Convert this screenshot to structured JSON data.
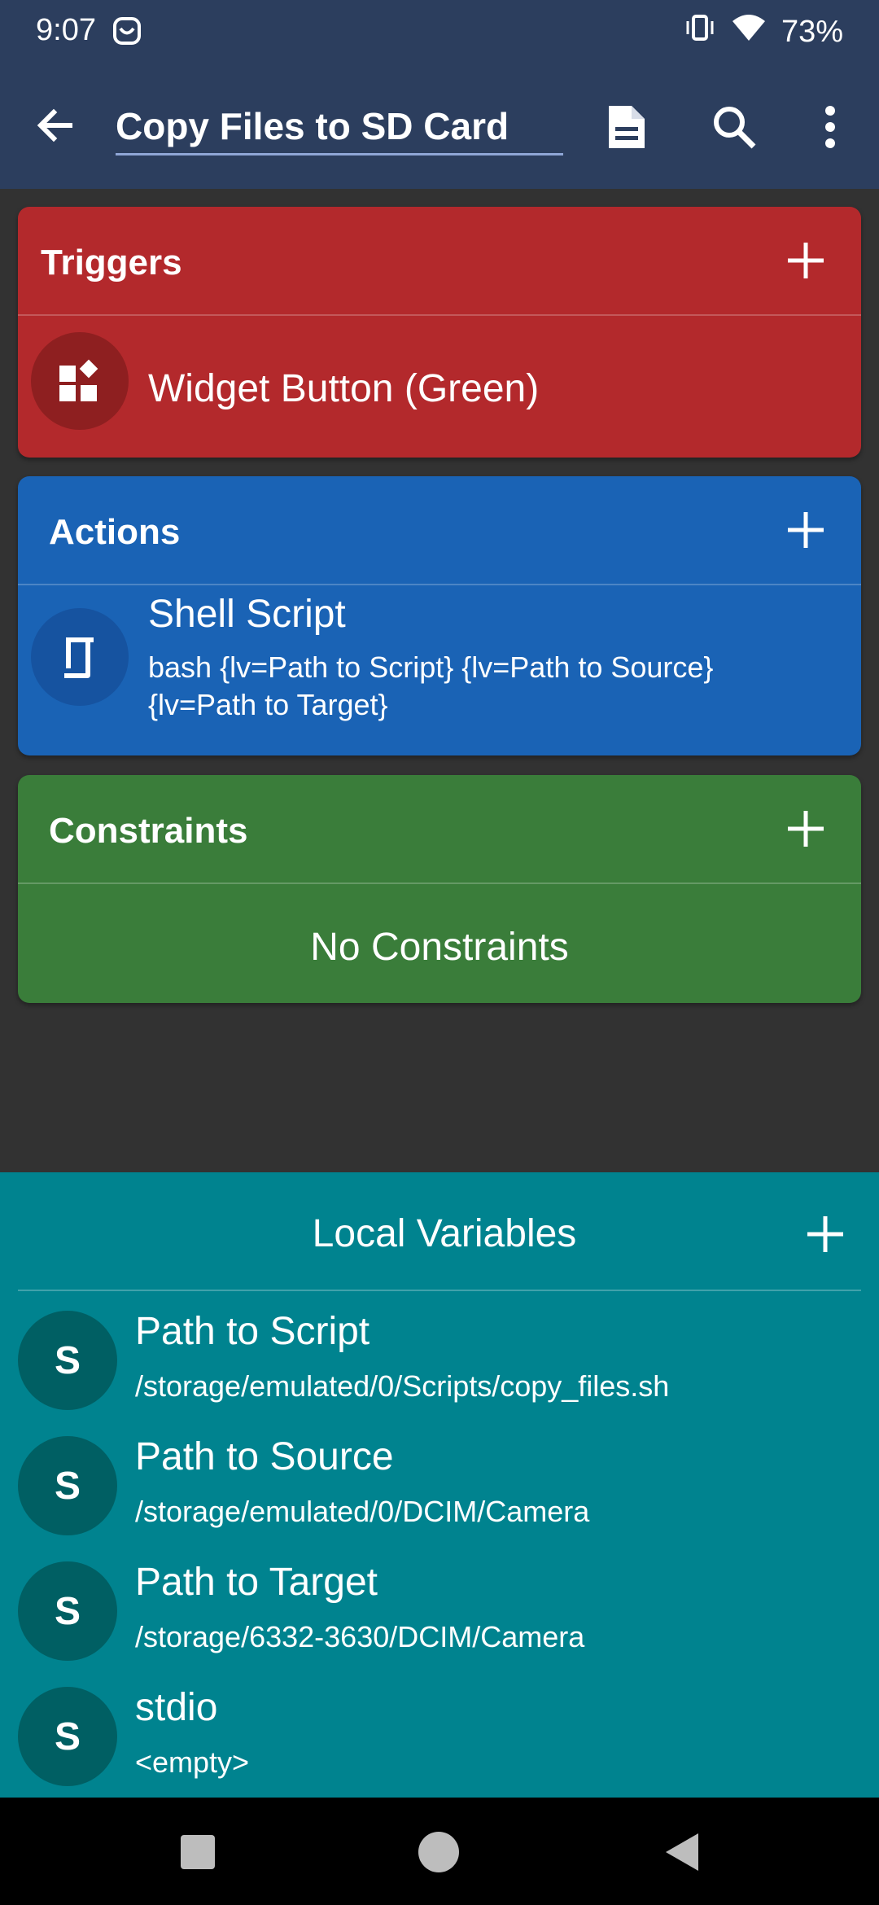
{
  "status_bar": {
    "time": "9:07",
    "battery": "73%"
  },
  "app_bar": {
    "macro_name": "Copy Files to SD Card",
    "icons": [
      "back-arrow-icon",
      "document-icon",
      "search-icon",
      "more-vert-icon"
    ]
  },
  "triggers": {
    "title": "Triggers",
    "color": "#b3292c",
    "items": [
      {
        "label": "Widget Button (Green)",
        "icon": "widget-icon"
      }
    ]
  },
  "actions": {
    "title": "Actions",
    "color": "#1a63b5",
    "items": [
      {
        "label": "Shell Script",
        "detail_line1": "bash {lv=Path to Script} {lv=Path to Source}",
        "detail_line2": "{lv=Path to Target}",
        "icon": "shell-script-icon"
      }
    ]
  },
  "constraints": {
    "title": "Constraints",
    "color": "#3a7d3a",
    "empty_text": "No Constraints"
  },
  "local_variables": {
    "title": "Local Variables",
    "color": "#00838f",
    "items": [
      {
        "type": "S",
        "name": "Path to Script",
        "value": "/storage/emulated/0/Scripts/copy_files.sh"
      },
      {
        "type": "S",
        "name": "Path to Source",
        "value": "/storage/emulated/0/DCIM/Camera"
      },
      {
        "type": "S",
        "name": "Path to Target",
        "value": "/storage/6332-3630/DCIM/Camera"
      },
      {
        "type": "S",
        "name": "stdio",
        "value": "<empty>"
      }
    ]
  },
  "nav_bar": {
    "icons": [
      "recents-icon",
      "home-icon",
      "back-icon"
    ]
  }
}
